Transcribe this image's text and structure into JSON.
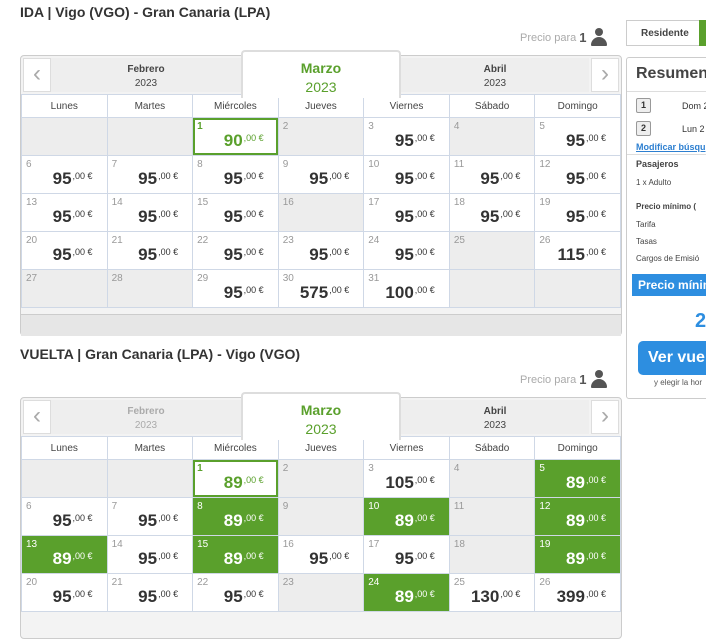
{
  "price_for": {
    "label": "Precio para",
    "count": "1"
  },
  "weekdays": [
    "Lunes",
    "Martes",
    "Miércoles",
    "Jueves",
    "Viernes",
    "Sábado",
    "Domingo"
  ],
  "currency_suffix": ",00 €",
  "outbound": {
    "title": "IDA | Vigo (VGO) - Gran Canaria (LPA)",
    "prev_month": {
      "name": "Febrero",
      "year": "2023"
    },
    "current_month": {
      "name": "Marzo",
      "year": "2023"
    },
    "next_month": {
      "name": "Abril",
      "year": "2023"
    },
    "days": [
      {
        "d": "1",
        "p": "90",
        "sel": true
      },
      {
        "d": "2",
        "p": ""
      },
      {
        "d": "3",
        "p": "95"
      },
      {
        "d": "4",
        "p": ""
      },
      {
        "d": "5",
        "p": "95"
      },
      {
        "d": "6",
        "p": "95"
      },
      {
        "d": "7",
        "p": "95"
      },
      {
        "d": "8",
        "p": "95"
      },
      {
        "d": "9",
        "p": "95"
      },
      {
        "d": "10",
        "p": "95"
      },
      {
        "d": "11",
        "p": "95"
      },
      {
        "d": "12",
        "p": "95"
      },
      {
        "d": "13",
        "p": "95"
      },
      {
        "d": "14",
        "p": "95"
      },
      {
        "d": "15",
        "p": "95"
      },
      {
        "d": "16",
        "p": ""
      },
      {
        "d": "17",
        "p": "95"
      },
      {
        "d": "18",
        "p": "95"
      },
      {
        "d": "19",
        "p": "95"
      },
      {
        "d": "20",
        "p": "95"
      },
      {
        "d": "21",
        "p": "95"
      },
      {
        "d": "22",
        "p": "95"
      },
      {
        "d": "23",
        "p": "95"
      },
      {
        "d": "24",
        "p": "95"
      },
      {
        "d": "25",
        "p": ""
      },
      {
        "d": "26",
        "p": "115"
      },
      {
        "d": "27",
        "p": ""
      },
      {
        "d": "28",
        "p": ""
      },
      {
        "d": "29",
        "p": "95"
      },
      {
        "d": "30",
        "p": "575"
      },
      {
        "d": "31",
        "p": "100"
      }
    ]
  },
  "return": {
    "title": "VUELTA | Gran Canaria (LPA) - Vigo (VGO)",
    "prev_month": {
      "name": "Febrero",
      "year": "2023"
    },
    "current_month": {
      "name": "Marzo",
      "year": "2023"
    },
    "next_month": {
      "name": "Abril",
      "year": "2023"
    },
    "days": [
      {
        "d": "1",
        "p": "89",
        "sel": true
      },
      {
        "d": "2",
        "p": ""
      },
      {
        "d": "3",
        "p": "105"
      },
      {
        "d": "4",
        "p": ""
      },
      {
        "d": "5",
        "p": "89",
        "green": true
      },
      {
        "d": "6",
        "p": "95"
      },
      {
        "d": "7",
        "p": "95"
      },
      {
        "d": "8",
        "p": "89",
        "green": true
      },
      {
        "d": "9",
        "p": ""
      },
      {
        "d": "10",
        "p": "89",
        "green": true
      },
      {
        "d": "11",
        "p": ""
      },
      {
        "d": "12",
        "p": "89",
        "green": true
      },
      {
        "d": "13",
        "p": "89",
        "green": true
      },
      {
        "d": "14",
        "p": "95"
      },
      {
        "d": "15",
        "p": "89",
        "green": true
      },
      {
        "d": "16",
        "p": "95"
      },
      {
        "d": "17",
        "p": "95"
      },
      {
        "d": "18",
        "p": ""
      },
      {
        "d": "19",
        "p": "89",
        "green": true
      },
      {
        "d": "20",
        "p": "95"
      },
      {
        "d": "21",
        "p": "95"
      },
      {
        "d": "22",
        "p": "95"
      },
      {
        "d": "23",
        "p": ""
      },
      {
        "d": "24",
        "p": "89",
        "green": true
      },
      {
        "d": "25",
        "p": "130"
      },
      {
        "d": "26",
        "p": "399"
      }
    ]
  },
  "sidebar": {
    "resident_label": "Residente",
    "summary_title": "Resumen",
    "legs": [
      {
        "n": "1",
        "text": "Dom 2"
      },
      {
        "n": "2",
        "text": "Lun 2"
      }
    ],
    "modify_label": "Modificar búsqu",
    "passengers_title": "Pasajeros",
    "passengers_value": "1 x Adulto",
    "min_price_title": "Precio mínimo (",
    "fare_label": "Tarifa",
    "taxes_label": "Tasas",
    "emission_label": "Cargos de Emisió",
    "min_price_banner": "Precio mínim",
    "big_value": "2",
    "return_button": "Ver vuel",
    "choose_text": "y elegir la hor"
  },
  "colors": {
    "accent_green": "#5aa02c",
    "accent_blue": "#2d8ee0"
  }
}
